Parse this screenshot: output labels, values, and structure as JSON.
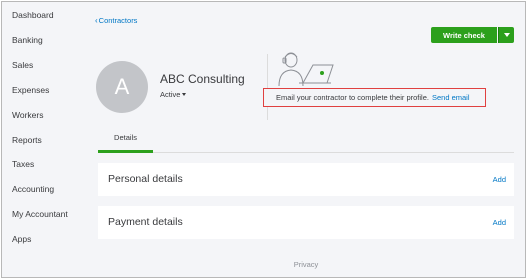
{
  "sidebar": {
    "items": [
      {
        "label": "Dashboard"
      },
      {
        "label": "Banking"
      },
      {
        "label": "Sales"
      },
      {
        "label": "Expenses"
      },
      {
        "label": "Workers"
      },
      {
        "label": "Reports"
      },
      {
        "label": "Taxes"
      },
      {
        "label": "Accounting"
      },
      {
        "label": "My Accountant"
      },
      {
        "label": "Apps"
      }
    ]
  },
  "header": {
    "back_glyph": "‹",
    "back_label": "Contractors",
    "write_check_label": "Write check"
  },
  "profile": {
    "avatar_initial": "A",
    "name": "ABC Consulting",
    "status": "Active"
  },
  "notice": {
    "text": "Email your contractor to complete their profile.",
    "link": "Send email",
    "highlight_color": "#e04040"
  },
  "tabs": [
    {
      "label": "Details",
      "active": true
    }
  ],
  "sections": [
    {
      "title": "Personal details",
      "action": "Add"
    },
    {
      "title": "Payment details",
      "action": "Add"
    }
  ],
  "footer": {
    "privacy": "Privacy"
  },
  "colors": {
    "accent_green": "#2ca01c",
    "link_blue": "#0077c5",
    "text": "#393a3d",
    "background": "#f4f5f8"
  },
  "icons": {
    "back": "chevron-left-icon",
    "dropdown": "caret-down-icon",
    "illustration": "contractor-laptop-illustration"
  }
}
